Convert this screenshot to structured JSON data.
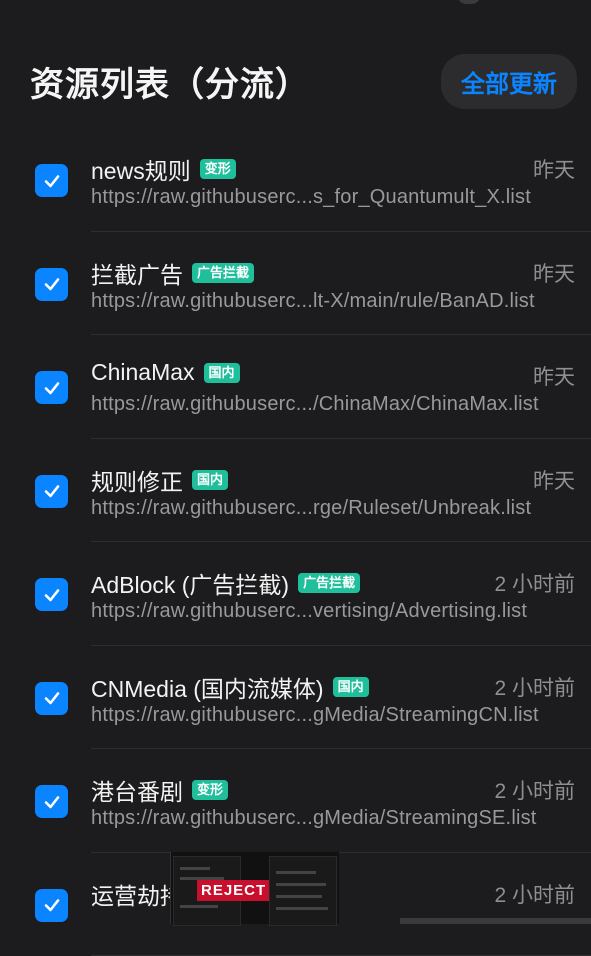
{
  "header": {
    "title": "资源列表（分流）",
    "update_all_label": "全部更新"
  },
  "rows": [
    {
      "name": "news规则",
      "tag": "变形",
      "time": "昨天",
      "url": "https://raw.githubuserc...s_for_Quantumult_X.list",
      "checked": true
    },
    {
      "name": "拦截广告",
      "tag": "广告拦截",
      "time": "昨天",
      "url": "https://raw.githubuserc...lt-X/main/rule/BanAD.list",
      "checked": true
    },
    {
      "name": "ChinaMax",
      "tag": "国内",
      "time": "昨天",
      "url": "https://raw.githubuserc.../ChinaMax/ChinaMax.list",
      "checked": true
    },
    {
      "name": "规则修正",
      "tag": "国内",
      "time": "昨天",
      "url": "https://raw.githubuserc...rge/Ruleset/Unbreak.list",
      "checked": true
    },
    {
      "name": "AdBlock (广告拦截)",
      "tag": "广告拦截",
      "time": "2 小时前",
      "url": "https://raw.githubuserc...vertising/Advertising.list",
      "checked": true
    },
    {
      "name": "CNMedia (国内流媒体)",
      "tag": "国内",
      "time": "2 小时前",
      "url": "https://raw.githubuserc...gMedia/StreamingCN.list",
      "checked": true
    },
    {
      "name": "港台番剧",
      "tag": "变形",
      "time": "2 小时前",
      "url": "https://raw.githubuserc...gMedia/StreamingSE.list",
      "checked": true
    },
    {
      "name": "运营劫持",
      "tag": "",
      "time": "2 小时前",
      "url": "",
      "checked": true
    }
  ],
  "overlay": {
    "reject_label": "REJECT"
  },
  "colors": {
    "accent": "#0a84ff",
    "tag": "#1fbf9c",
    "background": "#1c1c1e"
  }
}
